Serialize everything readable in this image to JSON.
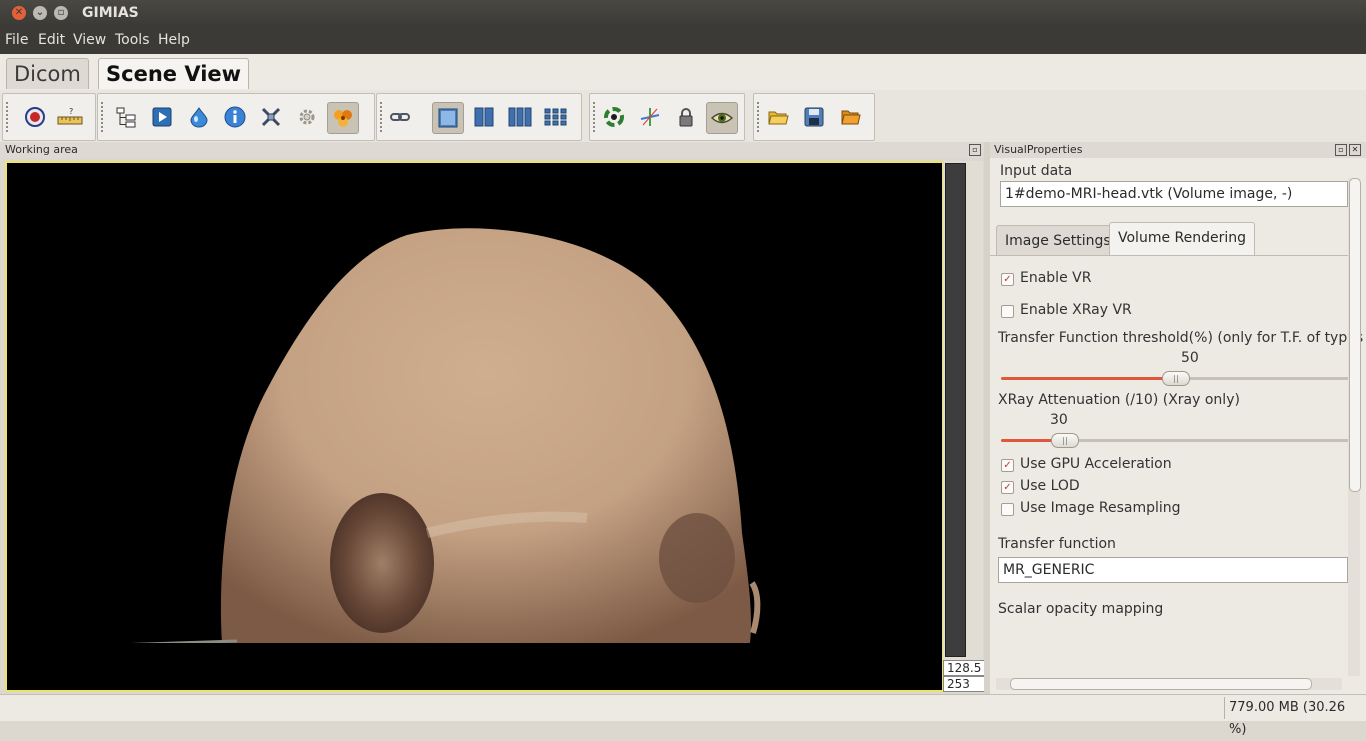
{
  "window": {
    "title": "GIMIAS"
  },
  "menubar": {
    "items": [
      "File",
      "Edit",
      "View",
      "Tools",
      "Help"
    ]
  },
  "tabs": {
    "dicom": "Dicom",
    "scene_view": "Scene View"
  },
  "toolbar": {
    "group1": [
      "record-icon",
      "ruler-help-icon"
    ],
    "group2": [
      "tree-icon",
      "play-icon",
      "drop-icon",
      "info-icon",
      "tools-icon",
      "gear-icon",
      "plugins-icon"
    ],
    "group3": [
      "link-icon",
      "layout-single-icon",
      "layout-two-icon",
      "layout-three-icon",
      "layout-grid-icon"
    ],
    "group4": [
      "recycle-icon",
      "crosshair-icon",
      "lock-icon",
      "eye-icon"
    ],
    "group5": [
      "open-folder-icon",
      "save-icon",
      "folder-icon"
    ]
  },
  "working_area": {
    "title": "Working area",
    "value_top": "128.5",
    "value_bottom": "253"
  },
  "visual_properties": {
    "title": "VisualProperties",
    "input_data_label": "Input data",
    "input_data_value": "1#demo-MRI-head.vtk (Volume image, -)",
    "tabs": [
      "Image Settings",
      "Volume Rendering"
    ],
    "enable_vr": {
      "label": "Enable VR",
      "checked": true
    },
    "enable_xray_vr": {
      "label": "Enable XRay VR",
      "checked": false
    },
    "tf_threshold": {
      "label": "Transfer Function threshold(%) (only for T.F. of types X",
      "value": "50",
      "level": 0.5
    },
    "xray_attenuation": {
      "label": "XRay Attenuation (/10) (Xray only)",
      "value": "30",
      "level": 0.18
    },
    "use_gpu": {
      "label": "Use GPU Acceleration",
      "checked": true
    },
    "use_lod": {
      "label": "Use LOD",
      "checked": true
    },
    "use_resampling": {
      "label": "Use Image Resampling",
      "checked": false
    },
    "transfer_function_label": "Transfer function",
    "transfer_function_value": "MR_GENERIC",
    "scalar_opacity_label": "Scalar opacity mapping"
  },
  "status": {
    "memory": "779.00 MB (30.26 %)"
  },
  "colors": {
    "accent": "#e1573c",
    "viewport_border": "#ece46a"
  }
}
